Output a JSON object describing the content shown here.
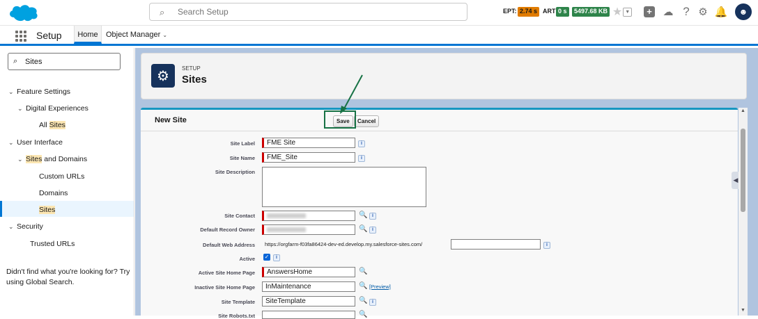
{
  "topbar": {
    "search_placeholder": "Search Setup",
    "ept_label": "EPT:",
    "ept_value": "2.74 s",
    "art_label": "ART",
    "art_value": "0 s",
    "memory_value": "5497.68 KB",
    "colors": {
      "ept": "#e07b00",
      "art": "#2e844a",
      "memory": "#2e844a"
    }
  },
  "nav": {
    "app_name": "Setup",
    "tabs": [
      {
        "label": "Home"
      },
      {
        "label": "Object Manager"
      }
    ]
  },
  "sidebar": {
    "search_value": "Sites",
    "tree": [
      {
        "label": "Feature Settings"
      },
      {
        "label": "Digital Experiences"
      },
      {
        "label_pre": "All ",
        "label_hl": "Sites"
      },
      {
        "label": "User Interface"
      },
      {
        "label_hl": "Sites",
        "label_post": " and Domains"
      },
      {
        "label": "Custom URLs"
      },
      {
        "label": "Domains"
      },
      {
        "label_hl": "Sites"
      },
      {
        "label": "Security"
      },
      {
        "label": "Trusted URLs"
      }
    ],
    "help_text": "Didn't find what you're looking for? Try using Global Search."
  },
  "header": {
    "breadcrumb": "SETUP",
    "title": "Sites"
  },
  "form": {
    "title": "New Site",
    "save_label": "Save",
    "cancel_label": "Cancel",
    "fields": {
      "site_label": {
        "label": "Site Label",
        "value": "FME Site"
      },
      "site_name": {
        "label": "Site Name",
        "value": "FME_Site"
      },
      "site_description": {
        "label": "Site Description",
        "value": ""
      },
      "site_contact": {
        "label": "Site Contact"
      },
      "default_record_owner": {
        "label": "Default Record Owner"
      },
      "default_web_address": {
        "label": "Default Web Address",
        "prefix": "https://orgfarm-f03fa86424-dev-ed.develop.my.salesforce-sites.com/",
        "value": ""
      },
      "active": {
        "label": "Active",
        "checked": true
      },
      "active_home": {
        "label": "Active Site Home Page",
        "value": "AnswersHome"
      },
      "inactive_home": {
        "label": "Inactive Site Home Page",
        "value": "InMaintenance",
        "preview_link": "[Preview]"
      },
      "site_template": {
        "label": "Site Template",
        "value": "SiteTemplate"
      },
      "site_robots": {
        "label": "Site Robots.txt",
        "value": ""
      }
    }
  }
}
